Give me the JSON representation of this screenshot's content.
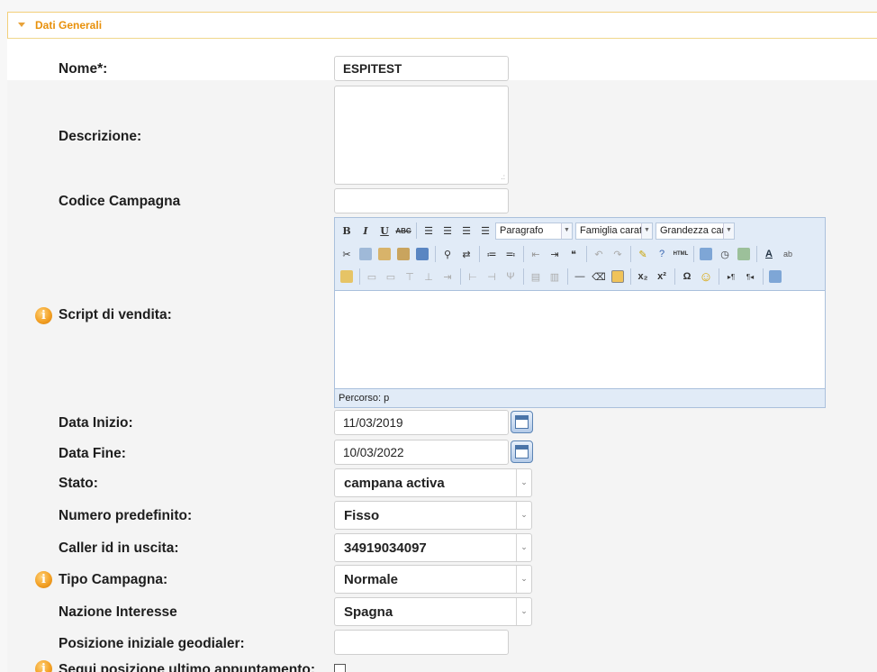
{
  "section": {
    "title": "Dati Generali"
  },
  "fields": {
    "nome": {
      "label": "Nome*:",
      "value": "ESPITEST"
    },
    "descrizione": {
      "label": "Descrizione:",
      "value": ""
    },
    "codice_campagna": {
      "label": "Codice Campagna",
      "value": ""
    },
    "script_vendita": {
      "label": "Script di vendita:"
    },
    "data_inizio": {
      "label": "Data Inizio:",
      "value": "11/03/2019"
    },
    "data_fine": {
      "label": "Data Fine:",
      "value": "10/03/2022"
    },
    "stato": {
      "label": "Stato:",
      "value": "campana activa"
    },
    "numero_predefinito": {
      "label": "Numero predefinito:",
      "value": "Fisso"
    },
    "caller_id": {
      "label": "Caller id in uscita:",
      "value": "34919034097"
    },
    "tipo_campagna": {
      "label": "Tipo Campagna:",
      "value": "Normale"
    },
    "nazione_interesse": {
      "label": "Nazione Interesse",
      "value": "Spagna"
    },
    "posizione_iniziale": {
      "label": "Posizione iniziale geodialer:",
      "value": ""
    },
    "segui_posizione": {
      "label": "Segui posizione ultimo appuntamento:",
      "checked": false
    }
  },
  "editor": {
    "format_select": "Paragrafo",
    "font_family_select": "Famiglia caratt",
    "font_size_select": "Grandezza car",
    "path_text": "Percorso: p"
  },
  "icons": {
    "info": "info-icon",
    "calendar": "calendar-icon"
  },
  "colors": {
    "header_text": "#e8900a",
    "header_border": "#f3cf7a",
    "editor_toolbar_bg": "#e1ebf7"
  }
}
